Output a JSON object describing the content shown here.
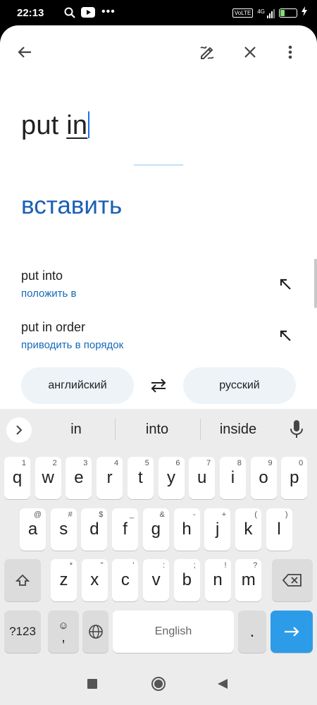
{
  "status_bar": {
    "time": "22:13",
    "network": "4G",
    "volte": "VoLTE",
    "battery": "27",
    "battery_level": 0.27,
    "left_icons": [
      "search-icon",
      "youtube-icon",
      "more-dots-icon"
    ]
  },
  "toolbar": {
    "icons": [
      "back-arrow-icon",
      "handwriting-icon",
      "close-icon",
      "more-vert-icon"
    ]
  },
  "input": {
    "word1": "put ",
    "word2": "in"
  },
  "translation": {
    "text": "вставить"
  },
  "suggestions": [
    {
      "source": "put into",
      "translation": "положить в"
    },
    {
      "source": "put in order",
      "translation": "приводить в порядок"
    }
  ],
  "languages": {
    "source": "английский",
    "target": "русский"
  },
  "keyboard": {
    "candidates": [
      "in",
      "into",
      "inside"
    ],
    "row1": [
      {
        "k": "q",
        "h": "1"
      },
      {
        "k": "w",
        "h": "2"
      },
      {
        "k": "e",
        "h": "3"
      },
      {
        "k": "r",
        "h": "4"
      },
      {
        "k": "t",
        "h": "5"
      },
      {
        "k": "y",
        "h": "6"
      },
      {
        "k": "u",
        "h": "7"
      },
      {
        "k": "i",
        "h": "8"
      },
      {
        "k": "o",
        "h": "9"
      },
      {
        "k": "p",
        "h": "0"
      }
    ],
    "row2": [
      {
        "k": "a",
        "h": "@"
      },
      {
        "k": "s",
        "h": "#"
      },
      {
        "k": "d",
        "h": "$"
      },
      {
        "k": "f",
        "h": "_"
      },
      {
        "k": "g",
        "h": "&"
      },
      {
        "k": "h",
        "h": "-"
      },
      {
        "k": "j",
        "h": "+"
      },
      {
        "k": "k",
        "h": "("
      },
      {
        "k": "l",
        "h": ")"
      }
    ],
    "row3": [
      {
        "k": "z",
        "h": "*"
      },
      {
        "k": "x",
        "h": "\""
      },
      {
        "k": "c",
        "h": "'"
      },
      {
        "k": "v",
        "h": ":"
      },
      {
        "k": "b",
        "h": ";"
      },
      {
        "k": "n",
        "h": "!"
      },
      {
        "k": "m",
        "h": "?"
      }
    ],
    "symbols_label": "?123",
    "comma": ",",
    "space_label": "English",
    "period": "."
  },
  "colors": {
    "accent": "#1a73e8",
    "translation": "#1a5fb4",
    "keyboard_bg": "#ececec"
  }
}
